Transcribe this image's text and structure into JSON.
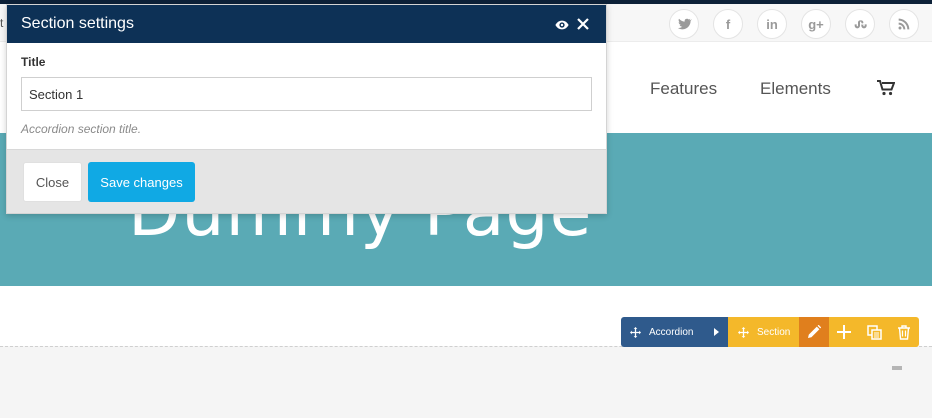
{
  "topbar": {
    "cut_text": "t",
    "social": [
      {
        "name": "twitter-icon"
      },
      {
        "name": "facebook-icon",
        "glyph": "f"
      },
      {
        "name": "linkedin-icon",
        "glyph": "in"
      },
      {
        "name": "google-plus-icon",
        "glyph": "g+"
      },
      {
        "name": "stumbleupon-icon"
      },
      {
        "name": "rss-icon"
      }
    ]
  },
  "nav": {
    "items": [
      "Features",
      "Elements"
    ],
    "cart_icon": "cart-icon"
  },
  "hero": {
    "title": "Dummy Page"
  },
  "modal": {
    "title": "Section settings",
    "header_icons": [
      "eye-icon",
      "close-icon"
    ],
    "field_label": "Title",
    "field_value": "Section 1",
    "field_hint": "Accordion section title.",
    "close_label": "Close",
    "save_label": "Save changes"
  },
  "toolbar": {
    "accordion_label": "Accordion",
    "section_label": "Section",
    "icons": [
      "move-icon",
      "pencil-icon",
      "plus-icon",
      "duplicate-icon",
      "trash-icon"
    ]
  },
  "colors": {
    "modal_header": "#0d3156",
    "hero_bg": "#5aaab5",
    "accordion_bar": "#2f5a8c",
    "section_bar": "#f4b82a",
    "edit_btn": "#e07f1d",
    "save_btn": "#10a9e4"
  }
}
